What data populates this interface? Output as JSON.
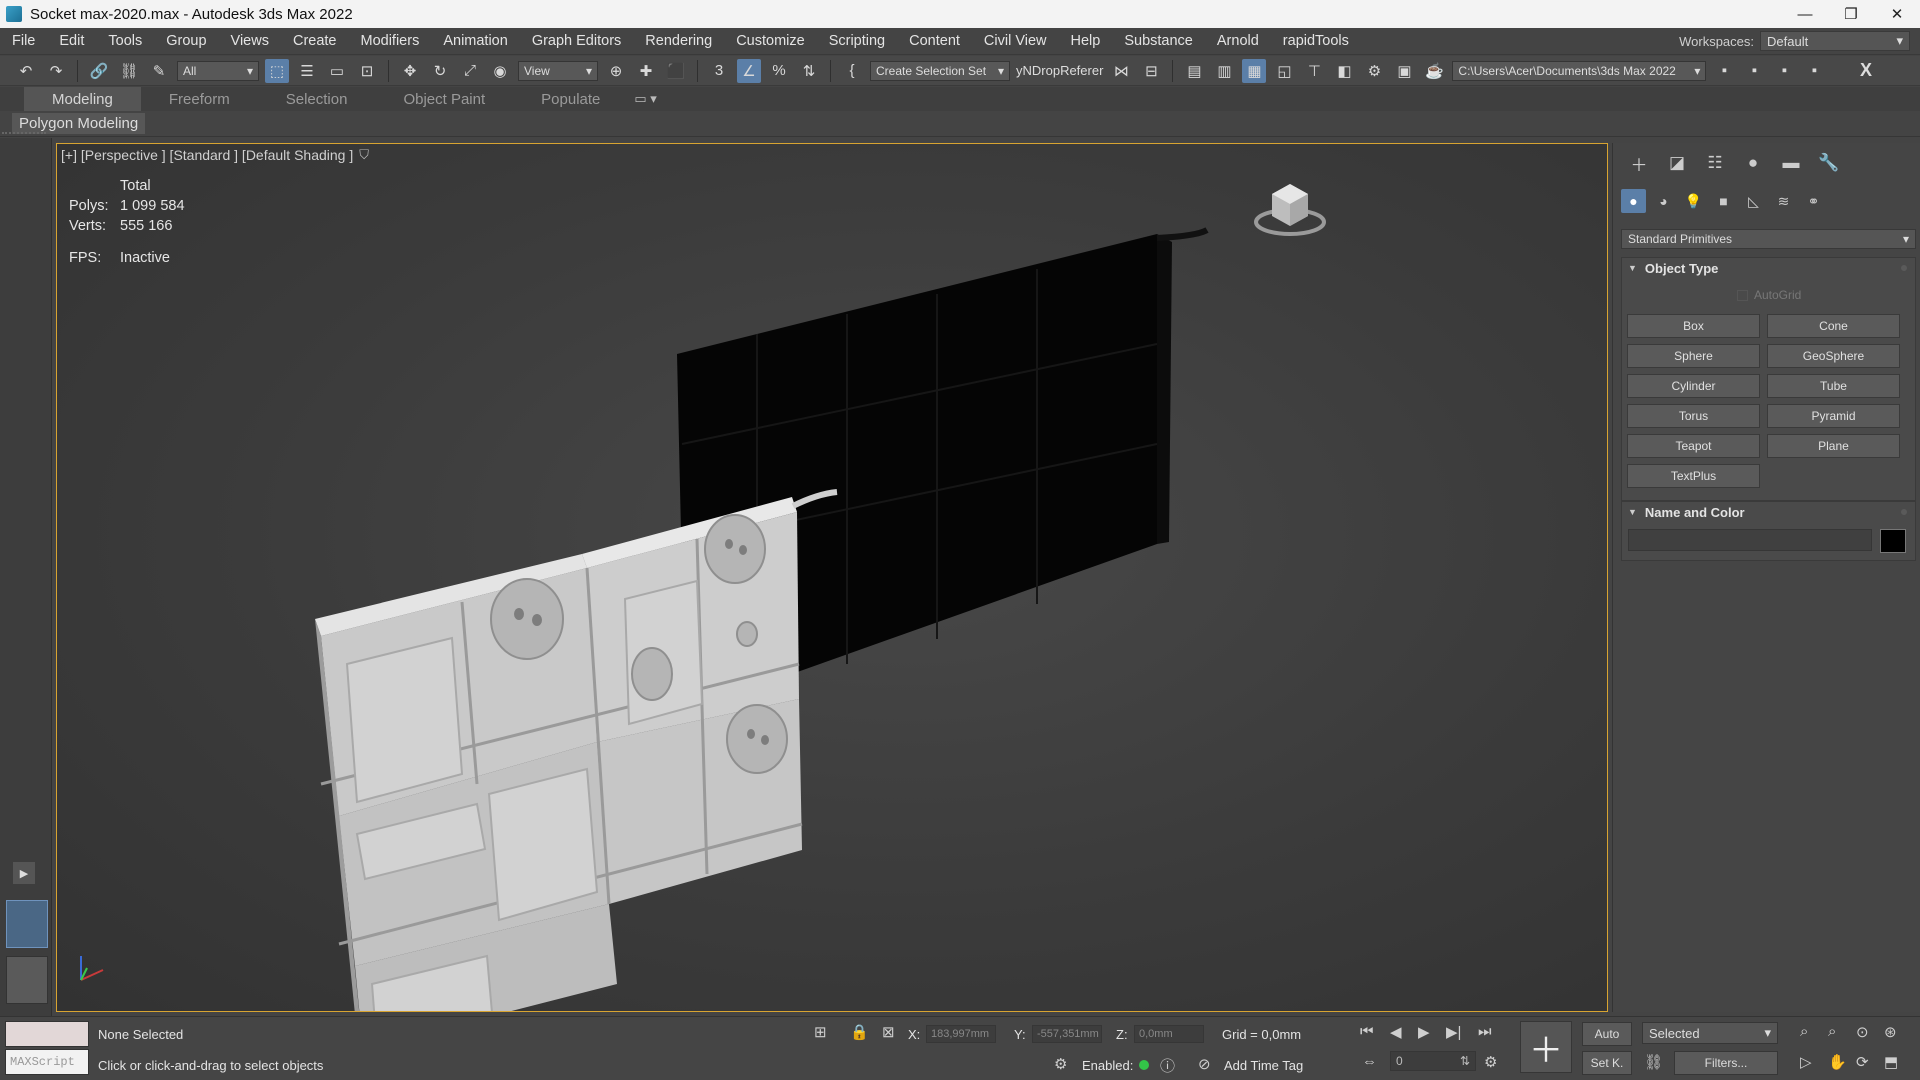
{
  "titlebar": {
    "title": "Socket max-2020.max - Autodesk 3ds Max 2022",
    "minimize": "—",
    "restore": "❐",
    "close": "✕"
  },
  "menu": {
    "items": [
      "File",
      "Edit",
      "Tools",
      "Group",
      "Views",
      "Create",
      "Modifiers",
      "Animation",
      "Graph Editors",
      "Rendering",
      "Customize",
      "Scripting",
      "Content",
      "Civil View",
      "Help",
      "Substance",
      "Arnold",
      "rapidTools"
    ],
    "workspaces_label": "Workspaces:",
    "workspace_value": "Default"
  },
  "toolbar": {
    "selection_filter": "All",
    "ref_coord": "View",
    "selection_set": "Create Selection Set",
    "drop_ref": "yNDropReferer",
    "path": "C:\\Users\\Acer\\Documents\\3ds Max 2022",
    "close_x": "X"
  },
  "ribbon": {
    "tabs": [
      "Modeling",
      "Freeform",
      "Selection",
      "Object Paint",
      "Populate"
    ],
    "active_tab": "Modeling",
    "panel_label": "Polygon Modeling"
  },
  "viewport": {
    "label": "[+] [Perspective ] [Standard ] [Default Shading ]",
    "stats": {
      "total": "Total",
      "polys_label": "Polys:",
      "polys_value": "1 099 584",
      "verts_label": "Verts:",
      "verts_value": "555 166",
      "fps_label": "FPS:",
      "fps_value": "Inactive"
    }
  },
  "command_panel": {
    "primitive_type": "Standard Primitives",
    "object_type_title": "Object Type",
    "autogrid": "AutoGrid",
    "buttons": [
      "Box",
      "Cone",
      "Sphere",
      "GeoSphere",
      "Cylinder",
      "Tube",
      "Torus",
      "Pyramid",
      "Teapot",
      "Plane",
      "TextPlus"
    ],
    "name_color_title": "Name and Color",
    "object_color": "#000000"
  },
  "status": {
    "maxscript_label": "MAXScript",
    "selection": "None Selected",
    "prompt": "Click or click-and-drag to select objects",
    "x_label": "X:",
    "x_value": "183,997mm",
    "y_label": "Y:",
    "y_value": "-557,351mm",
    "z_label": "Z:",
    "z_value": "0,0mm",
    "grid": "Grid = 0,0mm",
    "enabled_label": "Enabled:",
    "add_time_tag": "Add Time Tag",
    "auto_label": "Auto",
    "selected_value": "Selected",
    "set_key": "Set K.",
    "filters": "Filters...",
    "frame_value": "0"
  }
}
